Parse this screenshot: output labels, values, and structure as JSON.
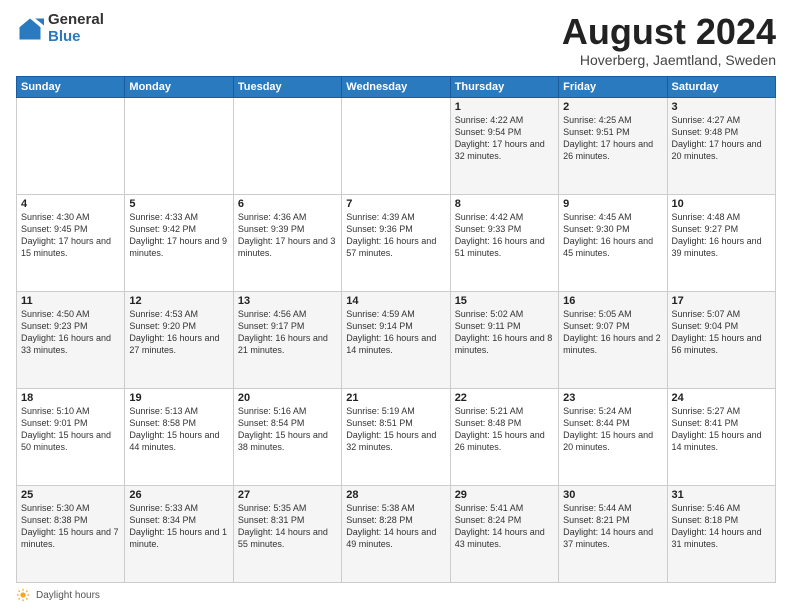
{
  "header": {
    "logo_general": "General",
    "logo_blue": "Blue",
    "title": "August 2024",
    "location": "Hoverberg, Jaemtland, Sweden"
  },
  "days_of_week": [
    "Sunday",
    "Monday",
    "Tuesday",
    "Wednesday",
    "Thursday",
    "Friday",
    "Saturday"
  ],
  "footer": {
    "label": "Daylight hours"
  },
  "weeks": [
    [
      {
        "day": "",
        "info": ""
      },
      {
        "day": "",
        "info": ""
      },
      {
        "day": "",
        "info": ""
      },
      {
        "day": "",
        "info": ""
      },
      {
        "day": "1",
        "info": "Sunrise: 4:22 AM\nSunset: 9:54 PM\nDaylight: 17 hours\nand 32 minutes."
      },
      {
        "day": "2",
        "info": "Sunrise: 4:25 AM\nSunset: 9:51 PM\nDaylight: 17 hours\nand 26 minutes."
      },
      {
        "day": "3",
        "info": "Sunrise: 4:27 AM\nSunset: 9:48 PM\nDaylight: 17 hours\nand 20 minutes."
      }
    ],
    [
      {
        "day": "4",
        "info": "Sunrise: 4:30 AM\nSunset: 9:45 PM\nDaylight: 17 hours\nand 15 minutes."
      },
      {
        "day": "5",
        "info": "Sunrise: 4:33 AM\nSunset: 9:42 PM\nDaylight: 17 hours\nand 9 minutes."
      },
      {
        "day": "6",
        "info": "Sunrise: 4:36 AM\nSunset: 9:39 PM\nDaylight: 17 hours\nand 3 minutes."
      },
      {
        "day": "7",
        "info": "Sunrise: 4:39 AM\nSunset: 9:36 PM\nDaylight: 16 hours\nand 57 minutes."
      },
      {
        "day": "8",
        "info": "Sunrise: 4:42 AM\nSunset: 9:33 PM\nDaylight: 16 hours\nand 51 minutes."
      },
      {
        "day": "9",
        "info": "Sunrise: 4:45 AM\nSunset: 9:30 PM\nDaylight: 16 hours\nand 45 minutes."
      },
      {
        "day": "10",
        "info": "Sunrise: 4:48 AM\nSunset: 9:27 PM\nDaylight: 16 hours\nand 39 minutes."
      }
    ],
    [
      {
        "day": "11",
        "info": "Sunrise: 4:50 AM\nSunset: 9:23 PM\nDaylight: 16 hours\nand 33 minutes."
      },
      {
        "day": "12",
        "info": "Sunrise: 4:53 AM\nSunset: 9:20 PM\nDaylight: 16 hours\nand 27 minutes."
      },
      {
        "day": "13",
        "info": "Sunrise: 4:56 AM\nSunset: 9:17 PM\nDaylight: 16 hours\nand 21 minutes."
      },
      {
        "day": "14",
        "info": "Sunrise: 4:59 AM\nSunset: 9:14 PM\nDaylight: 16 hours\nand 14 minutes."
      },
      {
        "day": "15",
        "info": "Sunrise: 5:02 AM\nSunset: 9:11 PM\nDaylight: 16 hours\nand 8 minutes."
      },
      {
        "day": "16",
        "info": "Sunrise: 5:05 AM\nSunset: 9:07 PM\nDaylight: 16 hours\nand 2 minutes."
      },
      {
        "day": "17",
        "info": "Sunrise: 5:07 AM\nSunset: 9:04 PM\nDaylight: 15 hours\nand 56 minutes."
      }
    ],
    [
      {
        "day": "18",
        "info": "Sunrise: 5:10 AM\nSunset: 9:01 PM\nDaylight: 15 hours\nand 50 minutes."
      },
      {
        "day": "19",
        "info": "Sunrise: 5:13 AM\nSunset: 8:58 PM\nDaylight: 15 hours\nand 44 minutes."
      },
      {
        "day": "20",
        "info": "Sunrise: 5:16 AM\nSunset: 8:54 PM\nDaylight: 15 hours\nand 38 minutes."
      },
      {
        "day": "21",
        "info": "Sunrise: 5:19 AM\nSunset: 8:51 PM\nDaylight: 15 hours\nand 32 minutes."
      },
      {
        "day": "22",
        "info": "Sunrise: 5:21 AM\nSunset: 8:48 PM\nDaylight: 15 hours\nand 26 minutes."
      },
      {
        "day": "23",
        "info": "Sunrise: 5:24 AM\nSunset: 8:44 PM\nDaylight: 15 hours\nand 20 minutes."
      },
      {
        "day": "24",
        "info": "Sunrise: 5:27 AM\nSunset: 8:41 PM\nDaylight: 15 hours\nand 14 minutes."
      }
    ],
    [
      {
        "day": "25",
        "info": "Sunrise: 5:30 AM\nSunset: 8:38 PM\nDaylight: 15 hours\nand 7 minutes."
      },
      {
        "day": "26",
        "info": "Sunrise: 5:33 AM\nSunset: 8:34 PM\nDaylight: 15 hours\nand 1 minute."
      },
      {
        "day": "27",
        "info": "Sunrise: 5:35 AM\nSunset: 8:31 PM\nDaylight: 14 hours\nand 55 minutes."
      },
      {
        "day": "28",
        "info": "Sunrise: 5:38 AM\nSunset: 8:28 PM\nDaylight: 14 hours\nand 49 minutes."
      },
      {
        "day": "29",
        "info": "Sunrise: 5:41 AM\nSunset: 8:24 PM\nDaylight: 14 hours\nand 43 minutes."
      },
      {
        "day": "30",
        "info": "Sunrise: 5:44 AM\nSunset: 8:21 PM\nDaylight: 14 hours\nand 37 minutes."
      },
      {
        "day": "31",
        "info": "Sunrise: 5:46 AM\nSunset: 8:18 PM\nDaylight: 14 hours\nand 31 minutes."
      }
    ]
  ]
}
